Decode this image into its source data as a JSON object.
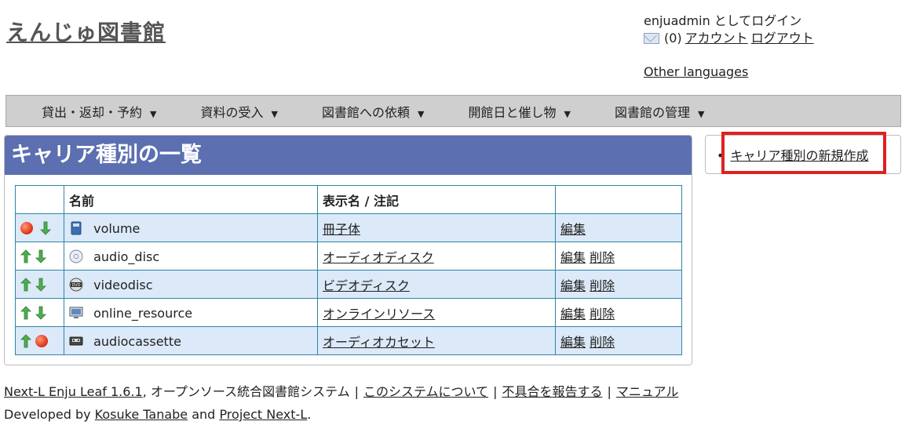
{
  "site": {
    "title": "えんじゅ図書館"
  },
  "login": {
    "status": "enjuadmin としてログイン",
    "message_count": "(0)",
    "account_link": "アカウント",
    "logout_link": "ログアウト",
    "other_languages": "Other languages"
  },
  "menu": {
    "items": [
      {
        "label": "貸出・返却・予約"
      },
      {
        "label": "資料の受入"
      },
      {
        "label": "図書館への依頼"
      },
      {
        "label": "開館日と催し物"
      },
      {
        "label": "図書館の管理"
      }
    ]
  },
  "main": {
    "title": "キャリア種別の一覧",
    "columns": {
      "name": "名前",
      "display": "表示名 / 注記"
    },
    "rows": [
      {
        "name": "volume",
        "display_name": "冊子体",
        "edit": "編集",
        "delete": "",
        "icon": "book-icon"
      },
      {
        "name": "audio_disc",
        "display_name": "オーディオディスク",
        "edit": "編集",
        "delete": "削除",
        "icon": "cd-icon"
      },
      {
        "name": "videodisc",
        "display_name": "ビデオディスク",
        "edit": "編集",
        "delete": "削除",
        "icon": "dvd-icon"
      },
      {
        "name": "online_resource",
        "display_name": "オンラインリソース",
        "edit": "編集",
        "delete": "削除",
        "icon": "computer-icon"
      },
      {
        "name": "audiocassette",
        "display_name": "オーディオカセット",
        "edit": "編集",
        "delete": "削除",
        "icon": "cassette-icon"
      }
    ]
  },
  "side": {
    "new_link": "キャリア種別の新規作成"
  },
  "footer": {
    "product": "Next-L Enju Leaf 1.6.1",
    "tagline": ", オープンソース統合図書館システム",
    "about": "このシステムについて",
    "report": "不具合を報告する",
    "manual": "マニュアル",
    "sep": "|",
    "developed_by": "Developed by",
    "author": "Kosuke Tanabe",
    "and": "and",
    "project": "Project Next-L",
    "period": "."
  },
  "colors": {
    "accent": "#5b6fb1",
    "highlight": "#e02020",
    "row_alt": "#dbe9f8"
  }
}
